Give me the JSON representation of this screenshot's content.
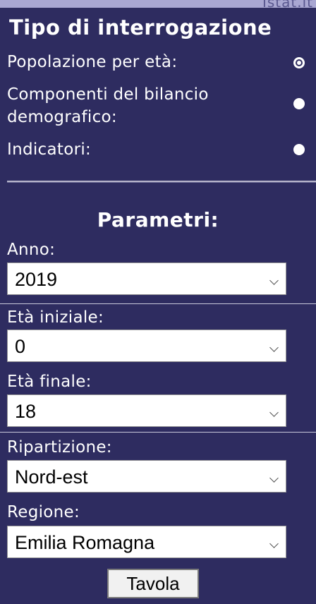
{
  "header": {
    "strip_text": "Istat.it"
  },
  "query_type": {
    "title": "Tipo di interrogazione",
    "options": [
      {
        "label": "Popolazione per età:",
        "selected": true
      },
      {
        "label_line1": "Componenti del bilancio",
        "label_line2": "demografico:",
        "selected": false
      },
      {
        "label": "Indicatori:",
        "selected": false
      }
    ]
  },
  "parameters": {
    "title": "Parametri:",
    "anno": {
      "label": "Anno:",
      "value": "2019"
    },
    "eta_iniziale": {
      "label": "Età iniziale:",
      "value": "0"
    },
    "eta_finale": {
      "label": "Età finale:",
      "value": "18"
    },
    "ripartizione": {
      "label": "Ripartizione:",
      "value": "Nord-est"
    },
    "regione": {
      "label": "Regione:",
      "value": "Emilia Romagna"
    }
  },
  "actions": {
    "submit_label": "Tavola"
  },
  "colors": {
    "background": "#2e2c60",
    "text": "#ffffff",
    "strip": "#a9a7d2"
  }
}
